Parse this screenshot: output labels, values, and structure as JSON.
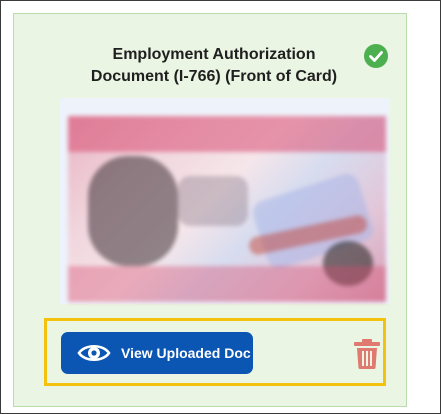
{
  "upload_card": {
    "title_line1": "Employment Authorization",
    "title_line2": "Document (I-766) (Front of Card)",
    "status_icon": "check-circle-icon",
    "status_color": "#4caf50",
    "document_image_alt": "Uploaded document preview (blurred)"
  },
  "actions": {
    "view_label": "View Uploaded Doc",
    "view_icon": "eye-icon",
    "delete_icon": "trash-icon",
    "primary_color": "#0b55b3",
    "delete_color": "#e07a70",
    "highlight_color": "#f4c20d"
  }
}
